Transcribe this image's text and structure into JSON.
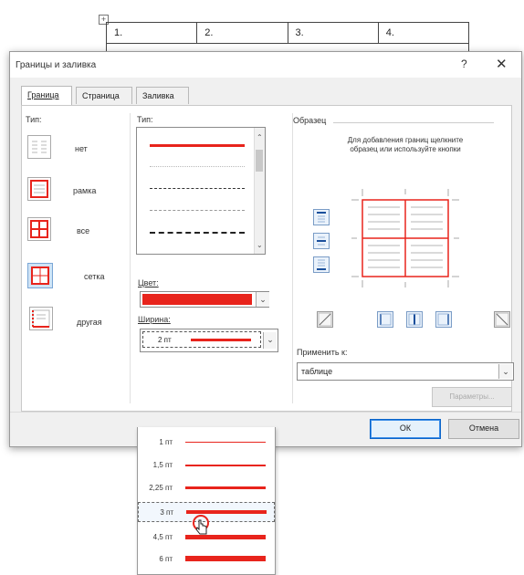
{
  "background_table": {
    "handle_icon": "+",
    "cells": [
      "1.",
      "2.",
      "3.",
      "4."
    ]
  },
  "dialog": {
    "title": "Границы и заливка",
    "help": "?",
    "close": "✕",
    "tabs": [
      {
        "label": "Граница",
        "active": true
      },
      {
        "label": "Страница",
        "active": false
      },
      {
        "label": "Заливка",
        "active": false
      }
    ],
    "type_label": "Тип:",
    "presets": [
      {
        "label": "нет",
        "selected": false
      },
      {
        "label": "рамка",
        "selected": false
      },
      {
        "label": "все",
        "selected": false
      },
      {
        "label": "сетка",
        "selected": true
      },
      {
        "label": "другая",
        "selected": false
      }
    ],
    "style_label": "Тип:",
    "color_label": "Цвет:",
    "width_label": "Ширина:",
    "width_value": "2 пт",
    "sample_label": "Образец",
    "sample_hint": "Для добавления границ щелкните образец или используйте кнопки",
    "apply_label": "Применить к:",
    "apply_value": "таблице",
    "params_button": "Параметры...",
    "ok_button": "ОК",
    "cancel_button": "Отмена",
    "accent_color": "#e8241c"
  },
  "width_dropdown": {
    "items": [
      {
        "label": "1 пт",
        "highlighted": false
      },
      {
        "label": "1,5 пт",
        "highlighted": false
      },
      {
        "label": "2,25 пт",
        "highlighted": false
      },
      {
        "label": "3 пт",
        "highlighted": true
      },
      {
        "label": "4,5 пт",
        "highlighted": false
      },
      {
        "label": "6 пт",
        "highlighted": false
      }
    ]
  }
}
